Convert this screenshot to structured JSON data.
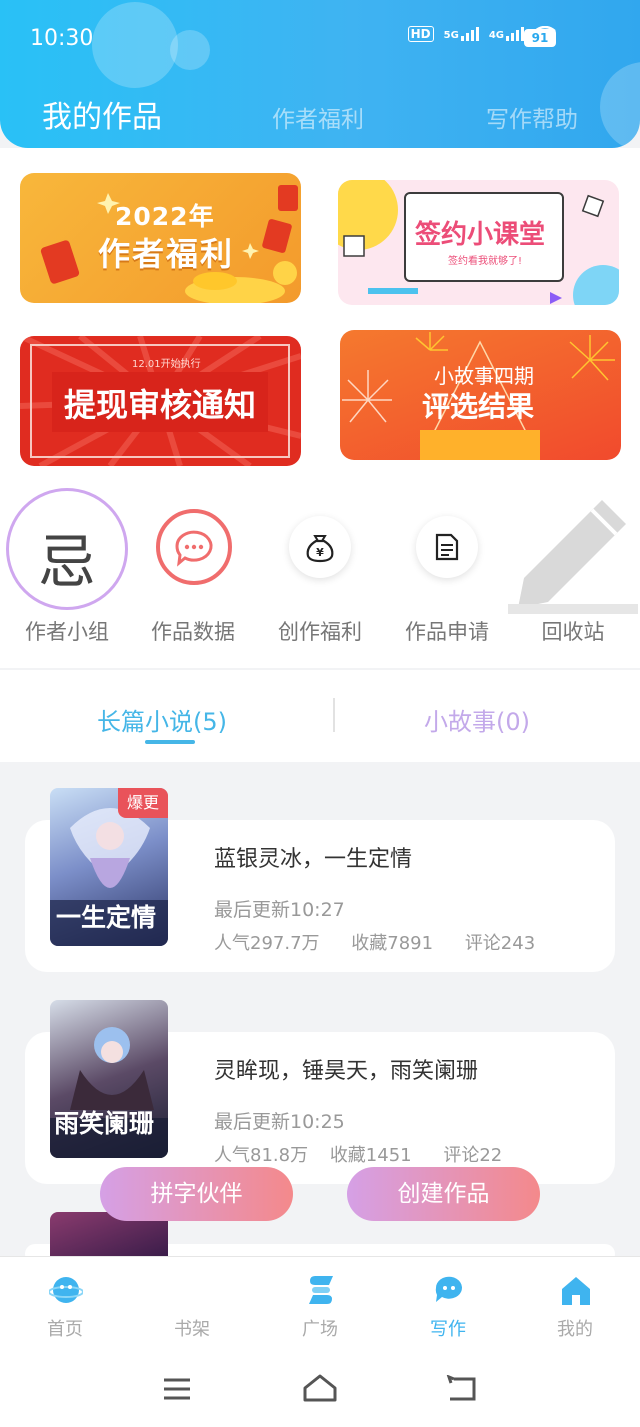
{
  "status": {
    "time": "10:30",
    "network1": "5G",
    "network2": "4G",
    "hd": "HD",
    "battery": "91"
  },
  "header": {
    "tabs": [
      "我的作品",
      "作者福利",
      "写作帮助"
    ],
    "active": 0
  },
  "banners": {
    "welfare": {
      "year": "2022年",
      "title": "作者福利"
    },
    "class": {
      "title": "签约小课堂",
      "subtitle": "签约看我就够了!"
    },
    "notice": {
      "note": "12.01开始执行",
      "title": "提现审核通知"
    },
    "story": {
      "line1": "小故事四期",
      "line2": "评选结果"
    }
  },
  "shortcuts": [
    {
      "label": "作者小组",
      "glyph": "忌",
      "icon": "author-group-icon"
    },
    {
      "label": "作品数据",
      "glyph": "···",
      "icon": "chat-bubble-icon"
    },
    {
      "label": "创作福利",
      "glyph": "¥",
      "icon": "money-bag-icon"
    },
    {
      "label": "作品申请",
      "glyph": "",
      "icon": "document-icon"
    },
    {
      "label": "回收站",
      "glyph": "",
      "icon": "pencil-icon"
    }
  ],
  "subtabs": [
    {
      "label": "长篇小说(5)"
    },
    {
      "label": "小故事(0)"
    }
  ],
  "books": [
    {
      "title": "蓝银灵冰，一生定情",
      "updated": "最后更新10:27",
      "popularity": "人气297.7万",
      "favorites": "收藏7891",
      "comments": "评论243",
      "badge": "爆更",
      "cover_text": "一生定情"
    },
    {
      "title": "灵眸现，锤昊天，雨笑阑珊",
      "updated": "最后更新10:25",
      "popularity": "人气81.8万",
      "favorites": "收藏1451",
      "comments": "评论22",
      "badge": "",
      "cover_text": "雨笑阑珊"
    }
  ],
  "fabs": {
    "partner": "拼字伙伴",
    "create": "创建作品"
  },
  "bottom_nav": [
    {
      "label": "首页",
      "icon": "planet-icon",
      "active": false
    },
    {
      "label": "书架",
      "icon": "bookshelf-icon",
      "active": false
    },
    {
      "label": "广场",
      "icon": "square-icon",
      "active": false
    },
    {
      "label": "写作",
      "icon": "write-chat-icon",
      "active": true
    },
    {
      "label": "我的",
      "icon": "home-icon",
      "active": false
    }
  ],
  "colors": {
    "brand": "#29c1f6",
    "accent": "#45b6e7",
    "fab_start": "#d5a0e6",
    "fab_end": "#f4898b"
  }
}
